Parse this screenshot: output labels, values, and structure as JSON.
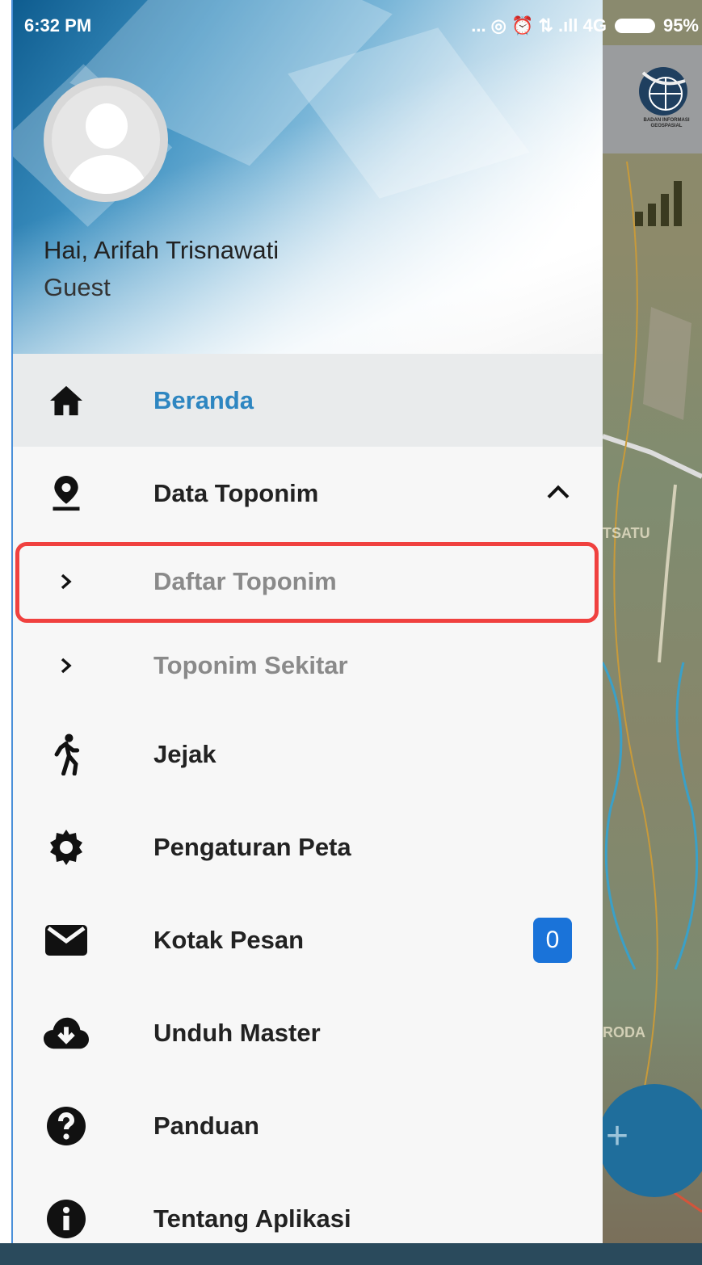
{
  "status_bar": {
    "time": "6:32 PM",
    "indicators": "... ◎ ⏰ ⇅ .ıll 4G",
    "battery": "95%"
  },
  "drawer_header": {
    "greeting": "Hai, Arifah Trisnawati",
    "role": "Guest"
  },
  "menu": {
    "beranda": "Beranda",
    "data_toponim": "Data Toponim",
    "daftar_toponim": "Daftar Toponim",
    "toponim_sekitar": "Toponim Sekitar",
    "jejak": "Jejak",
    "pengaturan_peta": "Pengaturan Peta",
    "kotak_pesan": "Kotak Pesan",
    "kotak_pesan_count": "0",
    "unduh_master": "Unduh Master",
    "panduan": "Panduan",
    "tentang_aplikasi": "Tentang Aplikasi"
  },
  "map_background": {
    "logo_text": "BADAN INFORMASI GEOSPASIAL",
    "label_1": "TSATU",
    "label_2": "RODA",
    "fab_symbol": "+"
  },
  "colors": {
    "accent": "#2e86c1",
    "highlight": "#f0413f",
    "badge": "#1a73d9"
  }
}
